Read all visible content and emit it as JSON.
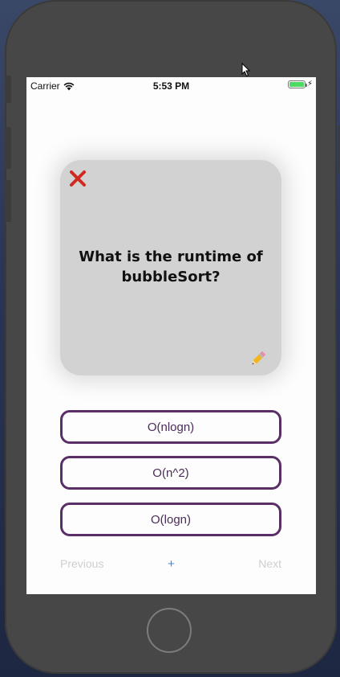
{
  "status_bar": {
    "carrier": "Carrier",
    "time": "5:53 PM"
  },
  "card": {
    "question": "What is the runtime of bubbleSort?",
    "close_icon": "close-x-icon",
    "edit_icon": "pencil-icon",
    "close_color": "#d0291f",
    "background": "#d2d2d2"
  },
  "answers": [
    {
      "label": "O(nlogn)"
    },
    {
      "label": "O(n^2)"
    },
    {
      "label": "O(logn)"
    }
  ],
  "navigation": {
    "previous_label": "Previous",
    "add_label": "+",
    "next_label": "Next"
  },
  "colors": {
    "accent_purple": "#5a2e67",
    "add_blue": "#3a86e0",
    "battery_green": "#4cd964"
  }
}
